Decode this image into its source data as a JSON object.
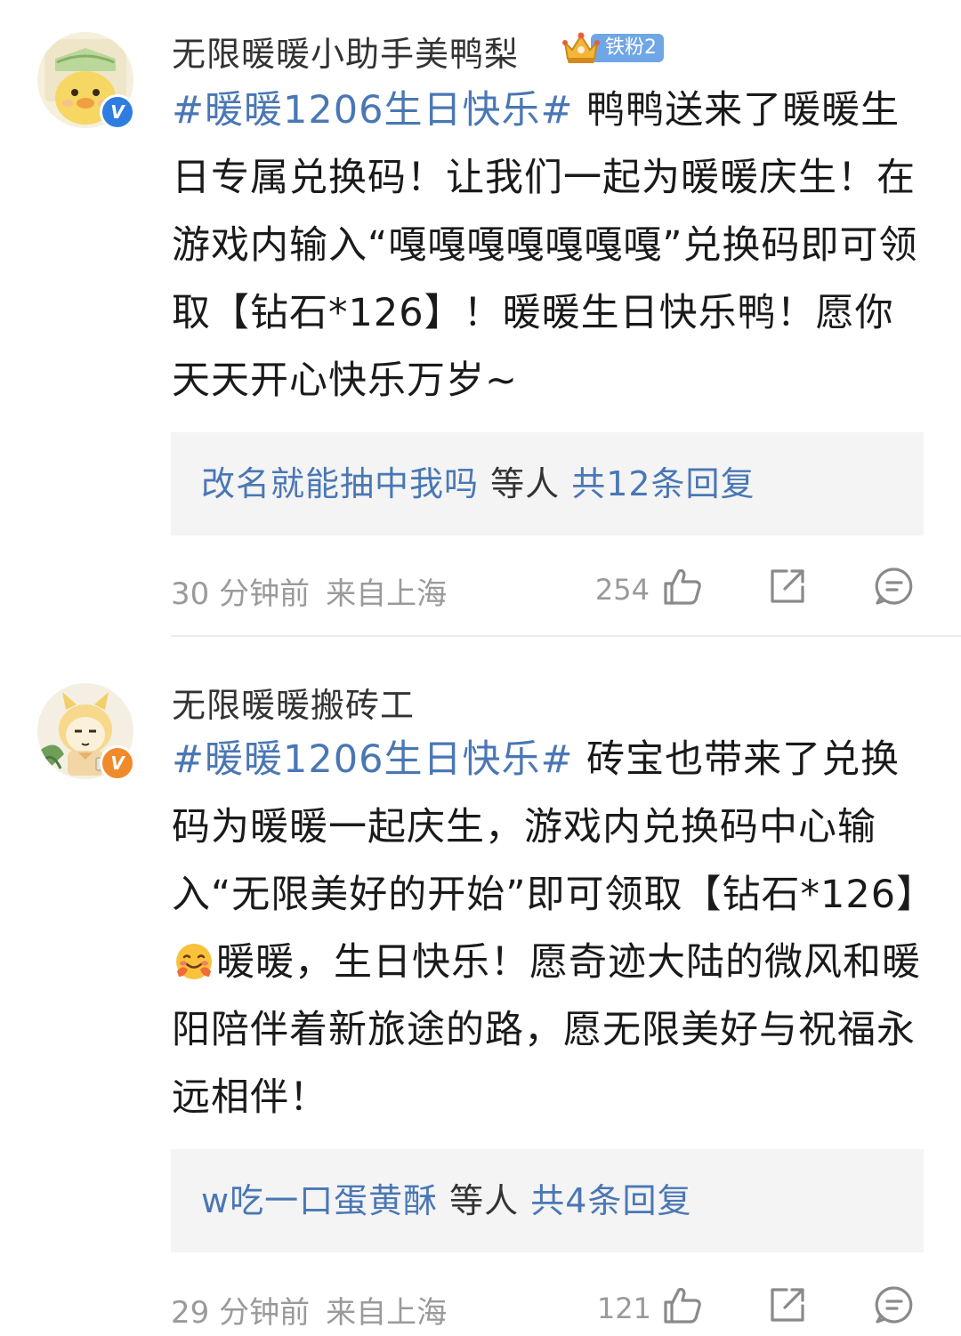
{
  "comments": [
    {
      "username": "无限暖暖小助手美鸭梨",
      "verified_color": "#2f7de0",
      "fan_badge": "铁粉2",
      "topic": "#暖暖1206生日快乐#",
      "text": "鸭鸭送来了暖暖生日专属兑换码！让我们一起为暖暖庆生！在游戏内输入“嘎嘎嘎嘎嘎嘎嘎”兑换码即可领取【钻石*126】！暖暖生日快乐鸭！愿你天天开心快乐万岁~",
      "reply_user": "改名就能抽中我吗",
      "reply_mid": " 等人 ",
      "reply_count": "共12条回复",
      "time": "30 分钟前",
      "location": "来自上海",
      "likes": "254",
      "icons": {
        "like": "thumbs-up-icon",
        "share": "share-icon",
        "comment": "comment-icon"
      }
    },
    {
      "username": "无限暖暖搬砖工",
      "verified_color": "#f08a2a",
      "topic": "#暖暖1206生日快乐#",
      "text_before_emoji": "砖宝也带来了兑换码为暖暖一起庆生，游戏内兑换码中心输入“无限美好的开始”即可领取【钻石*126】",
      "emoji": "hug-emoji",
      "text_after_emoji": "暖暖，生日快乐！愿奇迹大陆的微风和暖阳陪伴着新旅途的路，愿无限美好与祝福永远相伴！",
      "reply_user": "w吃一口蛋黄酥",
      "reply_mid": " 等人 ",
      "reply_count": "共4条回复",
      "time": "29 分钟前",
      "location": "来自上海",
      "likes": "121",
      "icons": {
        "like": "thumbs-up-icon",
        "share": "share-icon",
        "comment": "comment-icon"
      }
    }
  ],
  "colors": {
    "link_blue": "#4a77b4",
    "meta_gray": "#9a9a9a",
    "reply_bg": "#f4f4f4"
  }
}
